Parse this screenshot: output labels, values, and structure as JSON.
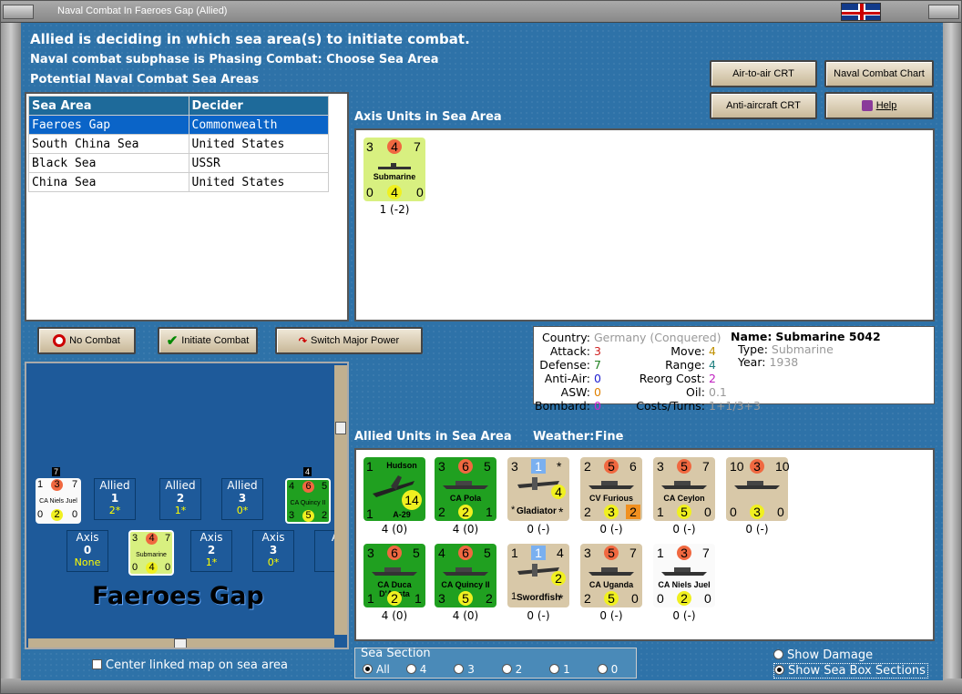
{
  "window": {
    "title": "Naval Combat In Faeroes Gap (Allied)"
  },
  "header": {
    "line1": "Allied is deciding in which sea area(s) to initiate combat.",
    "line2": "Naval combat subphase is Phasing Combat: Choose Sea Area",
    "line3": "Potential Naval Combat Sea Areas"
  },
  "buttons": {
    "air_crt": "Air-to-air CRT",
    "naval_chart": "Naval Combat Chart",
    "aa_crt": "Anti-aircraft CRT",
    "help": "Help",
    "no_combat": "No Combat",
    "initiate": "Initiate Combat",
    "switch": "Switch Major Power"
  },
  "table": {
    "headers": [
      "Sea Area",
      "Decider"
    ],
    "rows": [
      [
        "Faeroes Gap",
        "Commonwealth"
      ],
      [
        "South China Sea",
        "United States"
      ],
      [
        "Black Sea",
        "USSR"
      ],
      [
        "China Sea",
        "United States"
      ]
    ]
  },
  "axis_label": "Axis Units in Sea Area",
  "axis_unit": {
    "top": [
      "3",
      "4",
      "7"
    ],
    "name": "Submarine",
    "bottom": [
      "0",
      "4",
      "0"
    ],
    "sub": "1 (-2)"
  },
  "info": {
    "country_l": "Country:",
    "country": "Germany (Conquered)",
    "attack_l": "Attack:",
    "attack": "3",
    "defense_l": "Defense:",
    "defense": "7",
    "aa_l": "Anti-Air:",
    "aa": "0",
    "asw_l": "ASW:",
    "asw": "0",
    "bombard_l": "Bombard:",
    "bombard": "0",
    "move_l": "Move:",
    "move": "4",
    "range_l": "Range:",
    "range": "4",
    "reorg_l": "Reorg Cost:",
    "reorg": "2",
    "oil_l": "Oil:",
    "oil": "0.1",
    "costs_l": "Costs/Turns:",
    "costs": "1+1/3+3",
    "name_l": "Name:",
    "name": "Submarine 5042",
    "type_l": "Type:",
    "type": "Submarine",
    "year_l": "Year:",
    "year": "1938"
  },
  "allied_label": "Allied Units in Sea Area",
  "weather_label": "Weather:",
  "weather": "Fine",
  "allied_units": [
    {
      "name": "Hudson",
      "tl": "1",
      "bl": "1",
      "big": "14",
      "sub_name": "A-29",
      "sub": "4 (0)"
    },
    {
      "name": "CA Pola",
      "t": [
        "3",
        "6",
        "5"
      ],
      "b": [
        "2",
        "2",
        "1"
      ],
      "sub": "4 (0)"
    },
    {
      "name": "Gladiator",
      "t": [
        "3",
        "1",
        "*"
      ],
      "mid": "4",
      "b": [
        "*",
        "Gladiator",
        "*"
      ],
      "sub": "0 (-)"
    },
    {
      "name": "CV Furious",
      "t": [
        "2",
        "5",
        "6"
      ],
      "b": [
        "2",
        "3",
        "2"
      ],
      "sub": "0 (-)"
    },
    {
      "name": "CA Ceylon",
      "t": [
        "3",
        "5",
        "7"
      ],
      "b": [
        "1",
        "5",
        "0"
      ],
      "sub": "0 (-)"
    },
    {
      "name": "",
      "t": [
        "10",
        "3",
        "10"
      ],
      "b": [
        "0",
        "3",
        "0"
      ],
      "sub": "0 (-)"
    },
    {
      "name": "CA Duca D'Aosta",
      "t": [
        "3",
        "6",
        "5"
      ],
      "b": [
        "1",
        "2",
        "1"
      ],
      "sub": "4 (0)"
    },
    {
      "name": "CA Quincy II",
      "t": [
        "4",
        "6",
        "5"
      ],
      "b": [
        "3",
        "5",
        "2"
      ],
      "sub": "4 (0)"
    },
    {
      "name": "Swordfish",
      "t": [
        "1",
        "1",
        "4"
      ],
      "mid": "2",
      "b": [
        "1",
        "Swordfish",
        "*"
      ],
      "sub": "0 (-)"
    },
    {
      "name": "CA Uganda",
      "t": [
        "3",
        "5",
        "7"
      ],
      "b": [
        "2",
        "5",
        "0"
      ],
      "sub": "0 (-)"
    },
    {
      "name": "CA Niels Juel",
      "t": [
        "1",
        "3",
        "7"
      ],
      "b": [
        "0",
        "2",
        "0"
      ],
      "sub": "0 (-)"
    }
  ],
  "map": {
    "title": "Faeroes Gap",
    "allied_boxes": [
      {
        "l": "Allied",
        "n": "1",
        "v": "2*"
      },
      {
        "l": "Allied",
        "n": "2",
        "v": "1*"
      },
      {
        "l": "Allied",
        "n": "3",
        "v": "0*"
      }
    ],
    "axis_boxes": [
      {
        "l": "Axis",
        "n": "0",
        "v": "None"
      },
      {
        "l": "Axis",
        "n": "2",
        "v": "1*"
      },
      {
        "l": "Axis",
        "n": "3",
        "v": "0*"
      },
      {
        "l": "A",
        "n": "",
        "v": ""
      }
    ],
    "left_unit": {
      "t": [
        "1",
        "3",
        "7"
      ],
      "name": "CA Niels Juel",
      "b": [
        "0",
        "2",
        "0"
      ],
      "badge": "7"
    },
    "right_unit": {
      "t": [
        "4",
        "6",
        "5"
      ],
      "name": "CA Quincy II",
      "b": [
        "3",
        "5",
        "2"
      ],
      "badge": "4"
    },
    "sub_unit": {
      "t": [
        "3",
        "4",
        "7"
      ],
      "name": "Submarine",
      "b": [
        "0",
        "4",
        "0"
      ]
    }
  },
  "center_map": "Center linked map on sea area",
  "sea_section": {
    "label": "Sea Section",
    "options": [
      "All",
      "4",
      "3",
      "2",
      "1",
      "0"
    ],
    "selected": "All"
  },
  "show_damage": "Show Damage",
  "show_boxes": "Show Sea Box Sections"
}
